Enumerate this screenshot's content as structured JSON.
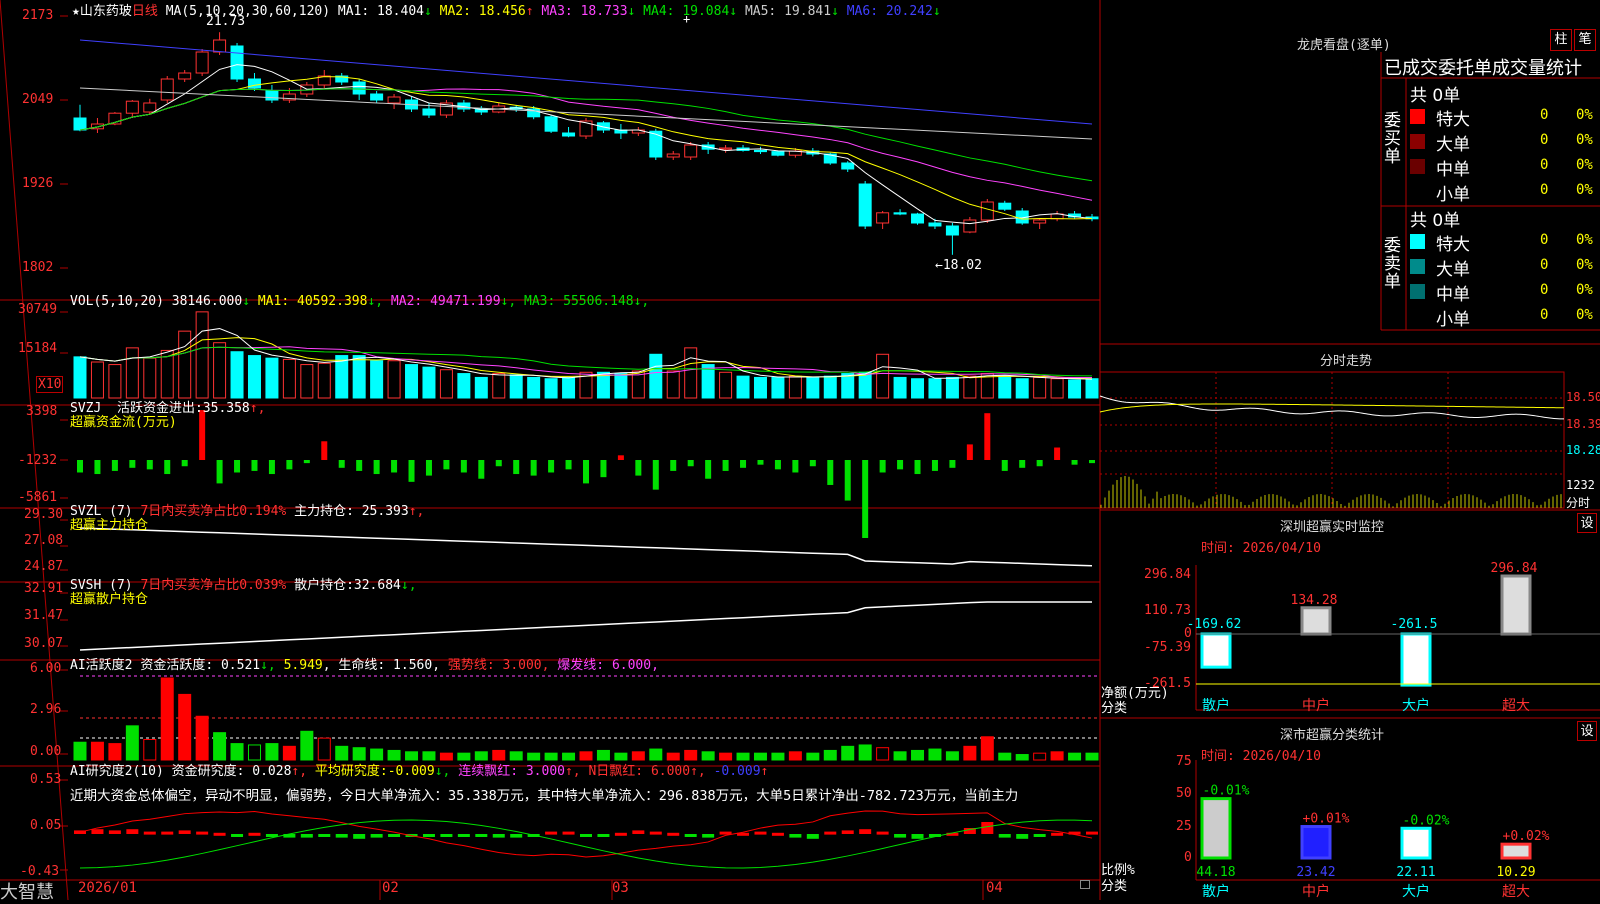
{
  "stock": {
    "star": "★",
    "name": "山东药玻",
    "period": "日线",
    "ma_params": "MA(5,10,20,30,60,120)",
    "ma": [
      {
        "label": "MA1:",
        "value": "18.404",
        "arrow": "↓",
        "color": "#ffffff"
      },
      {
        "label": "MA2:",
        "value": "18.456",
        "arrow": "↑",
        "color": "#ffff00"
      },
      {
        "label": "MA3:",
        "value": "18.733",
        "arrow": "↓",
        "color": "#ff44ff"
      },
      {
        "label": "MA4:",
        "value": "19.084",
        "arrow": "↓",
        "color": "#00e000"
      },
      {
        "label": "MA5:",
        "value": "19.841",
        "arrow": "↓",
        "color": "#cccccc"
      },
      {
        "label": "MA6:",
        "value": "20.242",
        "arrow": "↓",
        "color": "#4040ff"
      }
    ],
    "high_mark": "21.73",
    "low_mark": "←18.02"
  },
  "price_axis": [
    "2173",
    "2049",
    "1926",
    "1802"
  ],
  "vol": {
    "params": "VOL(5,10,20)",
    "value": "38146.000",
    "arrow": "↓",
    "ma": [
      {
        "label": "MA1:",
        "value": "40592.398",
        "arrow": "↓",
        "color": "#ffff00"
      },
      {
        "label": "MA2:",
        "value": "49471.199",
        "arrow": "↓",
        "color": "#ff44ff"
      },
      {
        "label": "MA3:",
        "value": "55506.148",
        "arrow": "↓",
        "color": "#00e000"
      }
    ],
    "axis": [
      "30749",
      "15184"
    ],
    "unit": "X10"
  },
  "svzj": {
    "name": "SVZJ",
    "line1_label": "活跃资金进出:",
    "line1_value": "35.358",
    "line1_arrow": "↑,",
    "line2": "超赢资金流(万元)",
    "axis": [
      "3398",
      "-1232",
      "-5861"
    ]
  },
  "svzl": {
    "name": "SVZL",
    "param": "(7)",
    "ratio_label": "7日内买卖净占比",
    "ratio_value": "0.194%",
    "hold_label": "主力持仓:",
    "hold_value": "25.393",
    "hold_arrow": "↑,",
    "line2": "超赢主力持仓",
    "axis": [
      "29.30",
      "27.08",
      "24.87"
    ]
  },
  "svsh": {
    "name": "SVSH",
    "param": "(7)",
    "ratio_label": "7日内买卖净占比",
    "ratio_value": "0.039%",
    "hold_label": "散户持仓:",
    "hold_value": "32.684",
    "hold_arrow": "↓,",
    "line2": "超赢散户持仓",
    "axis": [
      "32.91",
      "31.47",
      "30.07"
    ]
  },
  "ai_active": {
    "name": "AI活跃度2",
    "label": "资金活跃度:",
    "value": "0.521",
    "arrow": "↓,",
    "value2": "5.949",
    "life_label": "生命线:",
    "life_value": "1.560",
    "strong_label": "强势线:",
    "strong_value": "3.000",
    "burst_label": "爆发线:",
    "burst_value": "6.000",
    "axis": [
      "6.00",
      "2.96",
      "0.00"
    ]
  },
  "ai_research": {
    "name": "AI研究度2(10)",
    "label": "资金研究度:",
    "value": "0.028",
    "arrow": "↑,",
    "avg_label": "平均研究度:",
    "avg_value": "-0.009",
    "avg_arrow": "↓,",
    "red_label": "连续飘红:",
    "red_value": "3.000",
    "red_arrow": "↑,",
    "n_label": "N日飘红:",
    "n_value": "6.000",
    "n_arrow": "↑,",
    "last_value": "-0.009",
    "last_arrow": "↑",
    "commentary": "近期大资金总体偏空，异动不明显，偏弱势，今日大单净流入：35.338万元，其中特大单净流入：296.838万元，大单5日累计净出-782.723万元，当前主力",
    "axis": [
      "0.53",
      "0.05",
      "-0.43"
    ]
  },
  "time_axis": [
    "2026/01",
    "02",
    "03",
    "04"
  ],
  "brand": "大智慧",
  "dragon": {
    "title": "龙虎看盘(逐单)",
    "btn_bar": "柱",
    "btn_pen": "笔",
    "subtitle": "已成交委托单成交量统计",
    "buy_label": "委买单",
    "sell_label": "委卖单",
    "buy_total": "共 0单",
    "sell_total": "共 0单",
    "buy_rows": [
      {
        "name": "特大",
        "qty": "0",
        "pct": "0%",
        "color": "#ff0000"
      },
      {
        "name": "大单",
        "qty": "0",
        "pct": "0%",
        "color": "#8b0000"
      },
      {
        "name": "中单",
        "qty": "0",
        "pct": "0%",
        "color": "#6a0000"
      },
      {
        "name": "小单",
        "qty": "0",
        "pct": "0%",
        "color": ""
      }
    ],
    "sell_rows": [
      {
        "name": "特大",
        "qty": "0",
        "pct": "0%",
        "color": "#00ffff"
      },
      {
        "name": "大单",
        "qty": "0",
        "pct": "0%",
        "color": "#008b8b"
      },
      {
        "name": "中单",
        "qty": "0",
        "pct": "0%",
        "color": "#007070"
      },
      {
        "name": "小单",
        "qty": "0",
        "pct": "0%",
        "color": ""
      }
    ]
  },
  "intraday": {
    "title": "分时走势",
    "prices": [
      "18.50",
      "18.39",
      "18.28"
    ],
    "vol_label": "1232",
    "unit": "分时"
  },
  "sz_monitor": {
    "title": "深圳超赢实时监控",
    "btn": "设",
    "time_label": "时间:",
    "time": "2026/04/10",
    "axis": [
      "296.84",
      "110.73",
      "0",
      "-75.39",
      "-261.5"
    ],
    "ylabel": "净额(万元)",
    "xlabel": "分类",
    "categories": [
      "散户",
      "中户",
      "大户",
      "超大"
    ],
    "values": [
      -169.62,
      134.28,
      -261.5,
      296.84
    ],
    "value_labels": [
      "-169.62",
      "134.28",
      "-261.5",
      "296.84"
    ]
  },
  "sz_class": {
    "title": "深市超赢分类统计",
    "btn": "设",
    "time_label": "时间:",
    "time": "2026/04/10",
    "axis": [
      "75",
      "50",
      "25",
      "0"
    ],
    "ylabel": "比例%",
    "xlabel": "分类",
    "categories": [
      "散户",
      "中户",
      "大户",
      "超大"
    ],
    "values": [
      44.18,
      23.42,
      22.11,
      10.29
    ],
    "value_labels": [
      "44.18",
      "23.42",
      "22.11",
      "10.29"
    ],
    "change_labels": [
      "-0.01%",
      "+0.01%",
      "-0.02%",
      "+0.02%"
    ]
  },
  "colors": {
    "up": "#ff3232",
    "down": "#00ffff",
    "border": "#b00000",
    "label": "#ff3232"
  },
  "chart_data": [
    {
      "type": "candlestick",
      "title": "山东药玻 日线",
      "ylim": [
        17.8,
        22.0
      ],
      "ohlc": [
        [
          20.3,
          20.52,
          20.08,
          20.1
        ],
        [
          20.12,
          20.3,
          20.05,
          20.2
        ],
        [
          20.2,
          20.4,
          20.18,
          20.38
        ],
        [
          20.38,
          20.6,
          20.3,
          20.58
        ],
        [
          20.4,
          20.62,
          20.35,
          20.55
        ],
        [
          20.6,
          21.0,
          20.55,
          20.95
        ],
        [
          20.95,
          21.1,
          20.9,
          21.05
        ],
        [
          21.05,
          21.45,
          21.0,
          21.4
        ],
        [
          21.4,
          21.73,
          21.35,
          21.6
        ],
        [
          21.5,
          21.55,
          20.9,
          20.95
        ],
        [
          20.95,
          21.05,
          20.75,
          20.8
        ],
        [
          20.75,
          20.85,
          20.55,
          20.6
        ],
        [
          20.6,
          20.8,
          20.55,
          20.7
        ],
        [
          20.7,
          20.9,
          20.65,
          20.85
        ],
        [
          20.85,
          21.1,
          20.8,
          21.0
        ],
        [
          21.0,
          21.05,
          20.85,
          20.9
        ],
        [
          20.9,
          20.95,
          20.6,
          20.7
        ],
        [
          20.7,
          20.75,
          20.55,
          20.6
        ],
        [
          20.55,
          20.7,
          20.45,
          20.65
        ],
        [
          20.6,
          20.65,
          20.4,
          20.45
        ],
        [
          20.45,
          20.55,
          20.3,
          20.35
        ],
        [
          20.35,
          20.6,
          20.3,
          20.55
        ],
        [
          20.55,
          20.6,
          20.4,
          20.45
        ],
        [
          20.45,
          20.5,
          20.35,
          20.4
        ],
        [
          20.4,
          20.55,
          20.38,
          20.5
        ],
        [
          20.48,
          20.52,
          20.4,
          20.45
        ],
        [
          20.45,
          20.5,
          20.28,
          20.32
        ],
        [
          20.32,
          20.35,
          20.05,
          20.08
        ],
        [
          20.05,
          20.15,
          19.98,
          20.0
        ],
        [
          20.0,
          20.3,
          19.95,
          20.25
        ],
        [
          20.22,
          20.25,
          20.05,
          20.1
        ],
        [
          20.1,
          20.2,
          19.95,
          20.05
        ],
        [
          20.05,
          20.15,
          20.0,
          20.1
        ],
        [
          20.08,
          20.12,
          19.6,
          19.65
        ],
        [
          19.65,
          19.75,
          19.6,
          19.7
        ],
        [
          19.65,
          19.9,
          19.6,
          19.85
        ],
        [
          19.85,
          19.9,
          19.7,
          19.78
        ],
        [
          19.78,
          19.85,
          19.72,
          19.8
        ],
        [
          19.8,
          19.85,
          19.74,
          19.76
        ],
        [
          19.76,
          19.82,
          19.7,
          19.74
        ],
        [
          19.74,
          19.76,
          19.66,
          19.68
        ],
        [
          19.68,
          19.8,
          19.64,
          19.75
        ],
        [
          19.75,
          19.8,
          19.66,
          19.7
        ],
        [
          19.7,
          19.72,
          19.52,
          19.55
        ],
        [
          19.55,
          19.58,
          19.4,
          19.45
        ],
        [
          19.2,
          19.25,
          18.45,
          18.5
        ],
        [
          18.55,
          18.75,
          18.45,
          18.72
        ],
        [
          18.72,
          18.78,
          18.68,
          18.7
        ],
        [
          18.7,
          18.72,
          18.52,
          18.55
        ],
        [
          18.55,
          18.62,
          18.45,
          18.5
        ],
        [
          18.5,
          18.55,
          18.02,
          18.35
        ],
        [
          18.4,
          18.65,
          18.38,
          18.6
        ],
        [
          18.6,
          18.95,
          18.55,
          18.9
        ],
        [
          18.88,
          18.92,
          18.75,
          18.78
        ],
        [
          18.75,
          18.8,
          18.52,
          18.55
        ],
        [
          18.55,
          18.62,
          18.45,
          18.6
        ],
        [
          18.62,
          18.75,
          18.58,
          18.7
        ],
        [
          18.7,
          18.75,
          18.62,
          18.65
        ],
        [
          18.65,
          18.7,
          18.58,
          18.62
        ]
      ]
    },
    {
      "type": "bar",
      "title": "VOL",
      "values": [
        3200,
        2800,
        2600,
        3900,
        3100,
        3700,
        5200,
        6700,
        4300,
        3600,
        3300,
        3100,
        3000,
        2600,
        2700,
        3300,
        3300,
        2900,
        2900,
        2600,
        2400,
        2200,
        1900,
        1600,
        1900,
        1800,
        1600,
        1500,
        1600,
        2000,
        2000,
        1900,
        2100,
        3400,
        2100,
        3900,
        2600,
        2000,
        1700,
        1600,
        1600,
        1700,
        1600,
        1700,
        1900,
        2000,
        3400,
        1600,
        1500,
        1500,
        1600,
        1700,
        1900,
        1700,
        1500,
        1600,
        1500,
        1400,
        1500
      ]
    },
    {
      "type": "bar",
      "title": "超赢资金流(万元)",
      "values": [
        -800,
        -900,
        -700,
        -500,
        -600,
        -900,
        -400,
        3200,
        -1500,
        -800,
        -700,
        -900,
        -600,
        -200,
        1200,
        -500,
        -700,
        -900,
        -800,
        -1400,
        -1000,
        -600,
        -800,
        -1200,
        -400,
        -900,
        -1000,
        -800,
        -600,
        -1500,
        -1100,
        300,
        -1000,
        -1900,
        -700,
        -400,
        -1200,
        -700,
        -500,
        -300,
        -600,
        -800,
        -400,
        -1600,
        -2600,
        -5000,
        -800,
        -600,
        -900,
        -700,
        -500,
        1000,
        3000,
        -700,
        -500,
        -400,
        800,
        -300,
        -200
      ]
    },
    {
      "type": "line",
      "title": "超赢主力持仓",
      "ylim": [
        24.87,
        29.3
      ]
    },
    {
      "type": "line",
      "title": "超赢散户持仓",
      "ylim": [
        30.07,
        32.91
      ]
    },
    {
      "type": "bar",
      "title": "AI活跃度2",
      "ylim": [
        0,
        6.0
      ]
    },
    {
      "type": "bar",
      "title": "AI研究度2(10)",
      "ylim": [
        -0.43,
        0.53
      ]
    },
    {
      "type": "bar",
      "title": "深圳超赢实时监控",
      "categories": [
        "散户",
        "中户",
        "大户",
        "超大"
      ],
      "values": [
        -169.62,
        134.28,
        -261.5,
        296.84
      ],
      "ylabel": "净额(万元)",
      "xlabel": "分类"
    },
    {
      "type": "bar",
      "title": "深市超赢分类统计",
      "categories": [
        "散户",
        "中户",
        "大户",
        "超大"
      ],
      "values": [
        44.18,
        23.42,
        22.11,
        10.29
      ],
      "ylabel": "比例%",
      "xlabel": "分类",
      "ylim": [
        0,
        75
      ]
    }
  ]
}
